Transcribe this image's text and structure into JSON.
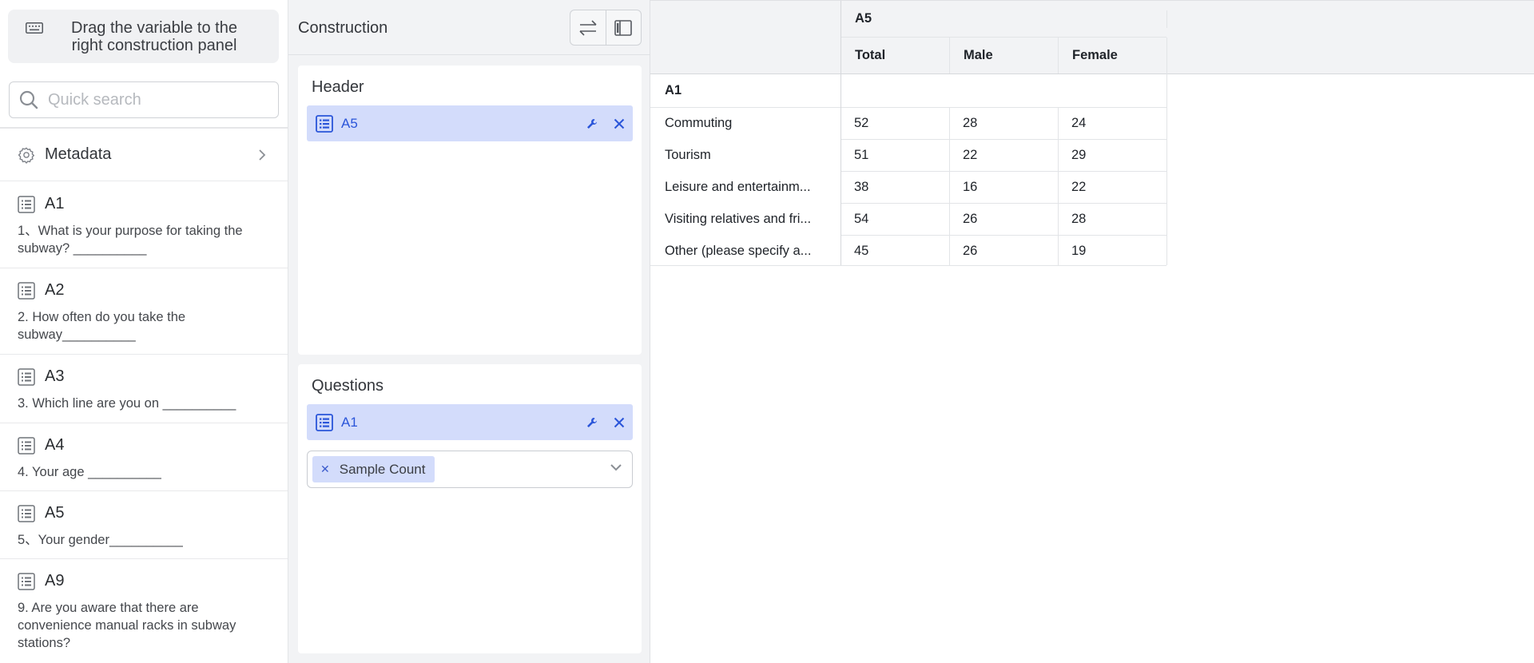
{
  "left_panel": {
    "hint_text": "Drag the variable to the right construction panel",
    "search_placeholder": "Quick search",
    "metadata_label": "Metadata",
    "variables": [
      {
        "code": "A1",
        "desc": "1、What is your purpose for taking the subway? __________"
      },
      {
        "code": "A2",
        "desc": "2. How often do you take the subway__________"
      },
      {
        "code": "A3",
        "desc": "3. Which line are you on __________"
      },
      {
        "code": "A4",
        "desc": "4. Your age __________"
      },
      {
        "code": "A5",
        "desc": "5、Your gender__________"
      },
      {
        "code": "A9",
        "desc": "9. Are you aware that there are convenience manual racks in subway stations?"
      }
    ]
  },
  "construction": {
    "title": "Construction",
    "header_title": "Header",
    "header_chip": "A5",
    "questions_title": "Questions",
    "questions_chip": "A1",
    "stat_tag": "Sample Count"
  },
  "table": {
    "column_group": "A5",
    "columns": [
      "Total",
      "Male",
      "Female"
    ],
    "row_group": "A1",
    "rows": [
      {
        "label": "Commuting",
        "values": [
          "52",
          "28",
          "24"
        ]
      },
      {
        "label": "Tourism",
        "values": [
          "51",
          "22",
          "29"
        ]
      },
      {
        "label": "Leisure and entertainm...",
        "values": [
          "38",
          "16",
          "22"
        ]
      },
      {
        "label": "Visiting relatives and fri...",
        "values": [
          "54",
          "26",
          "28"
        ]
      },
      {
        "label": "Other (please specify a...",
        "values": [
          "45",
          "26",
          "19"
        ]
      }
    ]
  },
  "colors": {
    "chip_bg": "#d3dcfb",
    "accent_blue": "#2a55d9",
    "panel_bg": "#f2f3f5"
  },
  "icons": {
    "hint": "keyboard-icon",
    "search": "search-icon",
    "metadata": "gear-icon",
    "variable": "list-icon",
    "swap": "swap-icon",
    "layout": "sidebar-layout-icon",
    "edit": "wrench-icon",
    "remove": "close-icon",
    "dropdown": "chevron-down-icon"
  }
}
